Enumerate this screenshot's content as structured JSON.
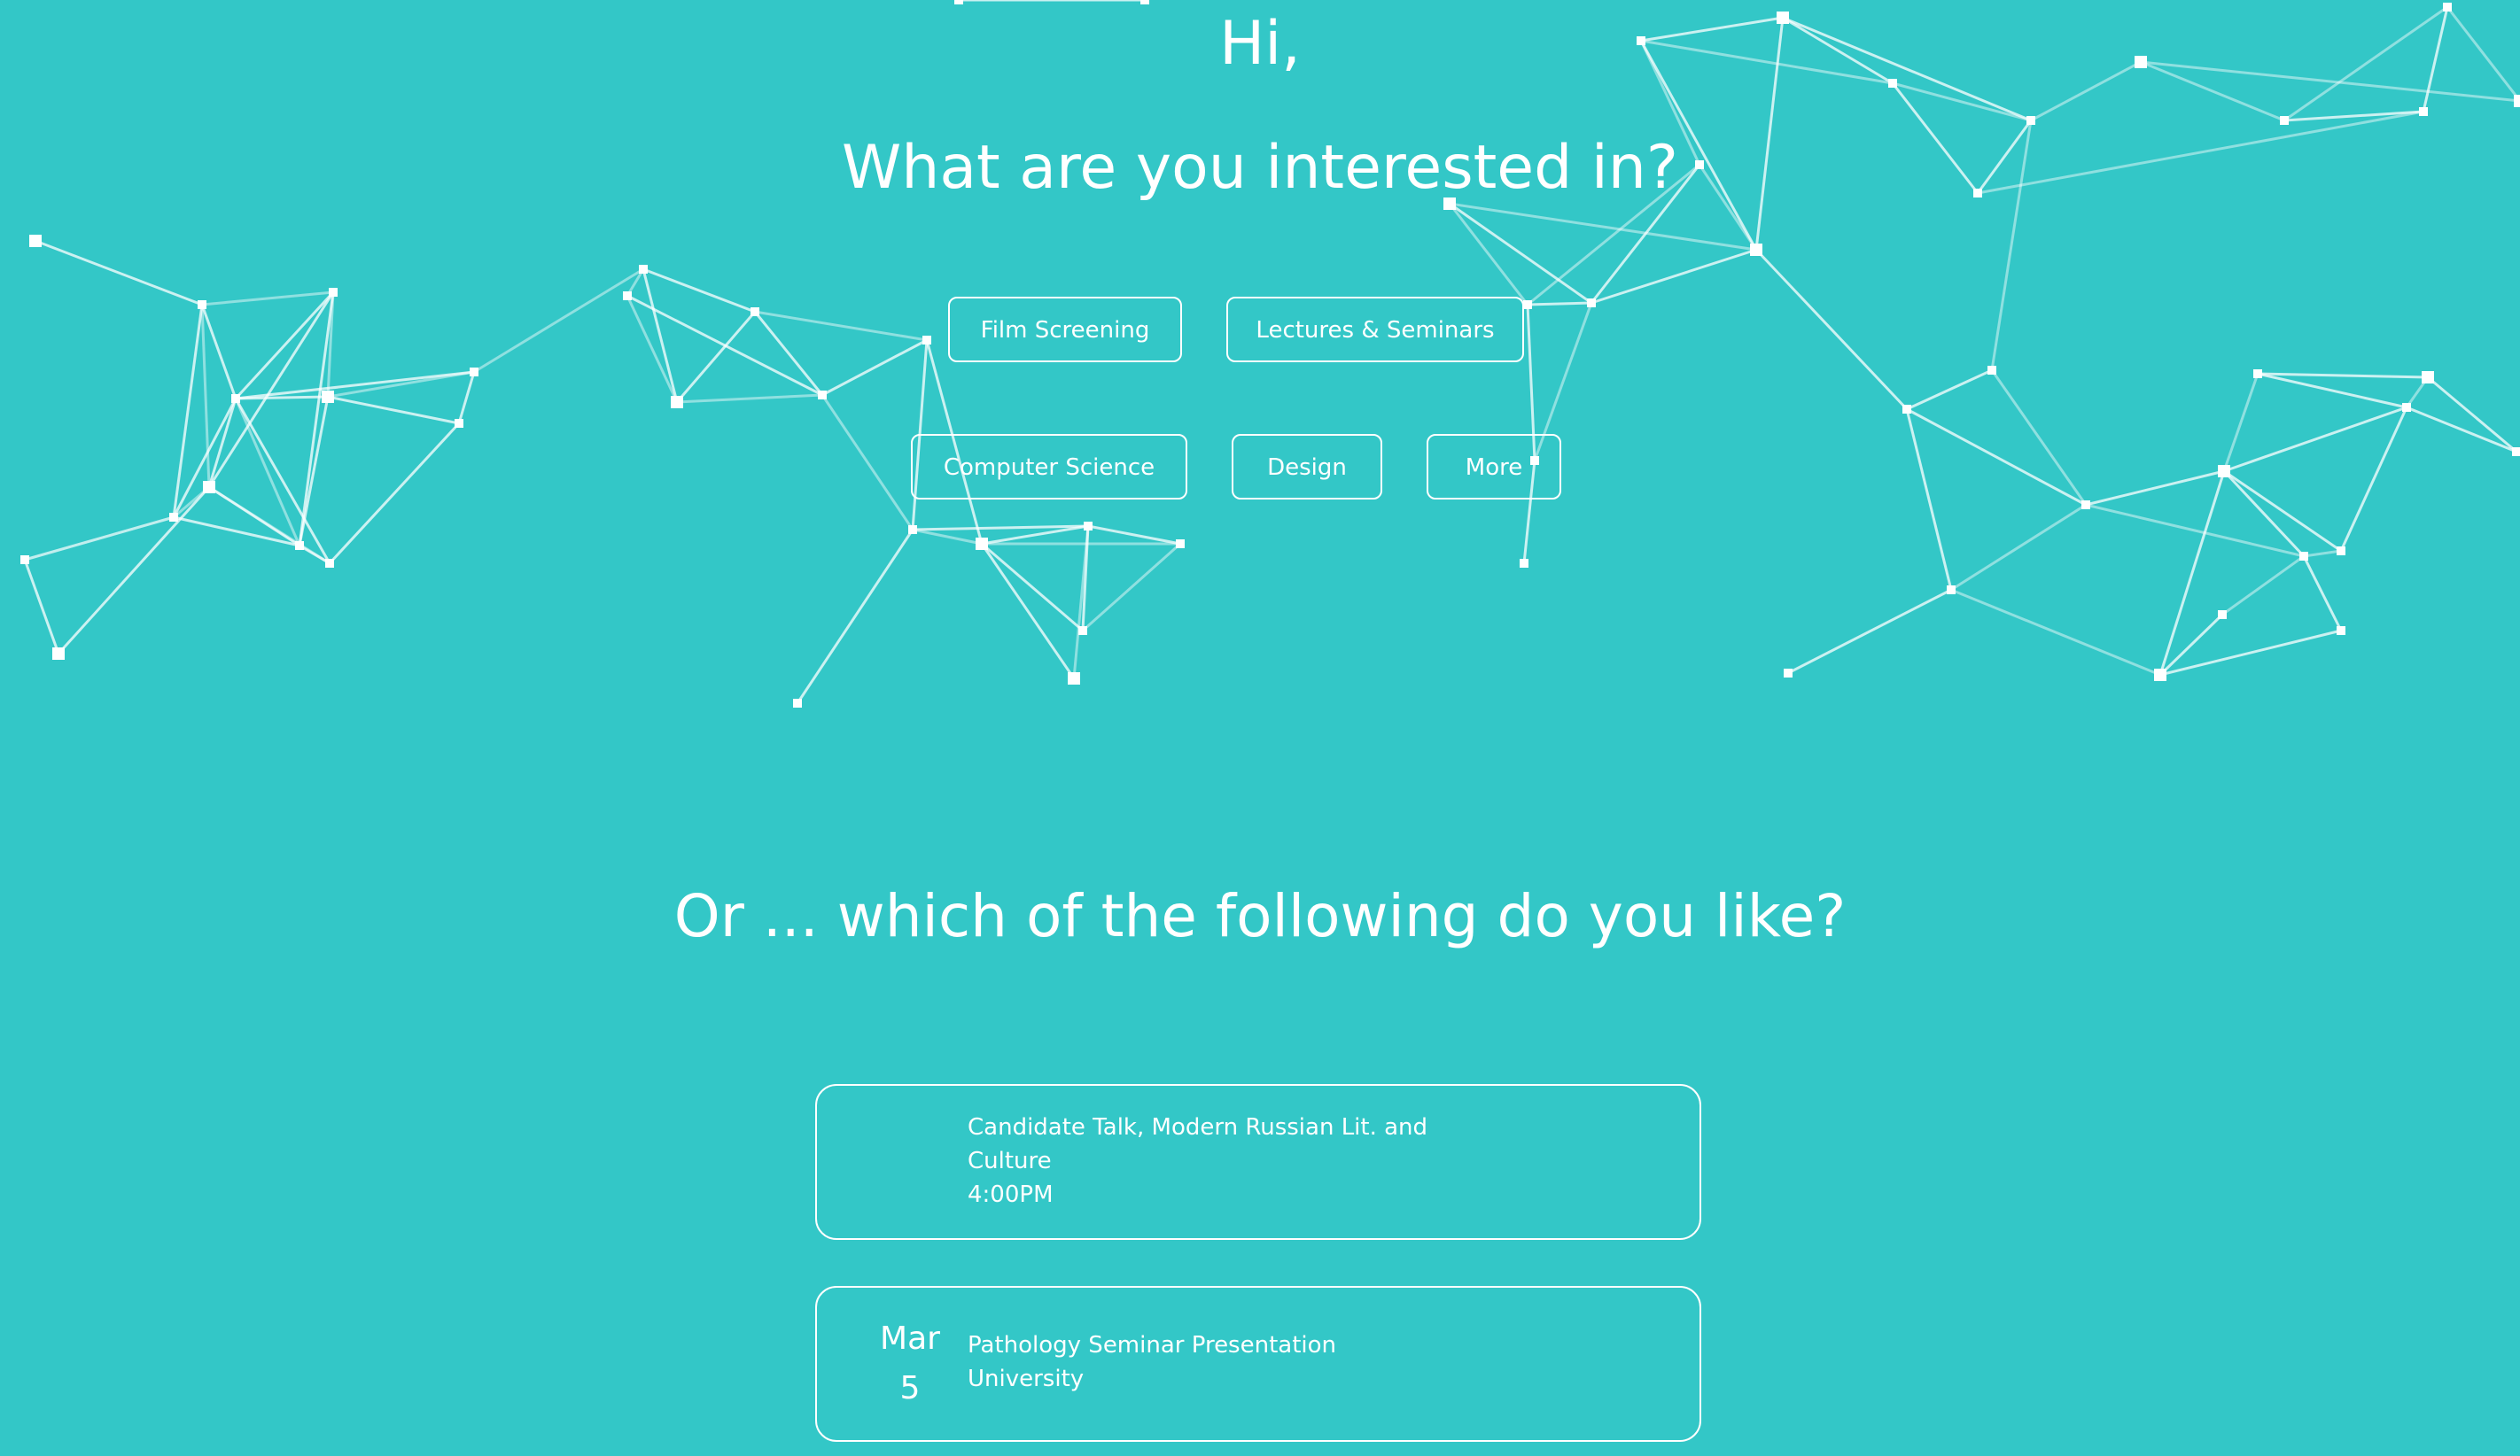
{
  "hero": {
    "greeting": "Hi,",
    "question": "What are you interested in?"
  },
  "categories": [
    {
      "label": "Film Screening"
    },
    {
      "label": "Lectures & Seminars"
    },
    {
      "label": "Computer Science"
    },
    {
      "label": "Design"
    },
    {
      "label": "More"
    }
  ],
  "suggestions": {
    "heading": "Or ... which of the following do you like?",
    "events": [
      {
        "month": "",
        "day": "",
        "title_line1": "Candidate Talk, Modern Russian Lit. and",
        "title_line2": "Culture",
        "detail": "4:00PM"
      },
      {
        "month": "Mar",
        "day": "5",
        "title_line1": "Pathology Seminar Presentation",
        "title_line2": "",
        "detail": "University"
      }
    ]
  },
  "colors": {
    "background": "#33c7c7",
    "foreground": "#ffffff"
  }
}
